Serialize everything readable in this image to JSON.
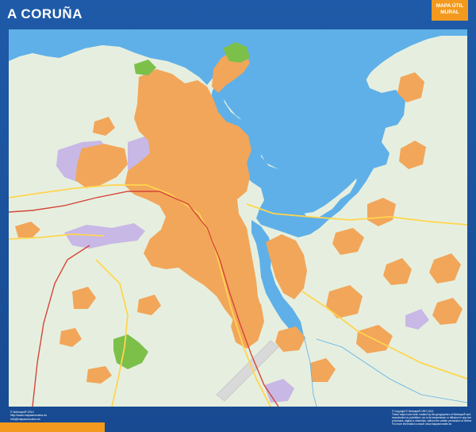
{
  "header": {
    "title": "A CORUÑA",
    "badge_line1": "MAPA ÚTIL",
    "badge_line2": "MURAL"
  },
  "footer": {
    "left_lines": [
      "© Netmaps® 2014",
      "http://www.mapasmurales.es",
      "info@mapasmurales.es"
    ],
    "right_lines": [
      "© Copyright © Netmaps® 1997-2014",
      "These maps have been created by the geographers of Netmaps® and no partial",
      "reproduction is prohibited, nor is its transmission or diffusion in any form, by their",
      "processes, digital or otherwise, without the written permission of Netmaps®.",
      "For more information consult: www.mapasmurales.es"
    ]
  },
  "colors": {
    "frame": "#1b4f9a",
    "sea": "#5fb0e8",
    "land": "#e6efdf",
    "urban": "#f2a65a",
    "industrial": "#c8b8e6",
    "park": "#7cc04a",
    "badge": "#f39a1e"
  },
  "map": {
    "features": [
      "sea",
      "land",
      "urban-areas",
      "industrial-areas",
      "parks",
      "roads",
      "rivers",
      "airport-runway"
    ]
  }
}
